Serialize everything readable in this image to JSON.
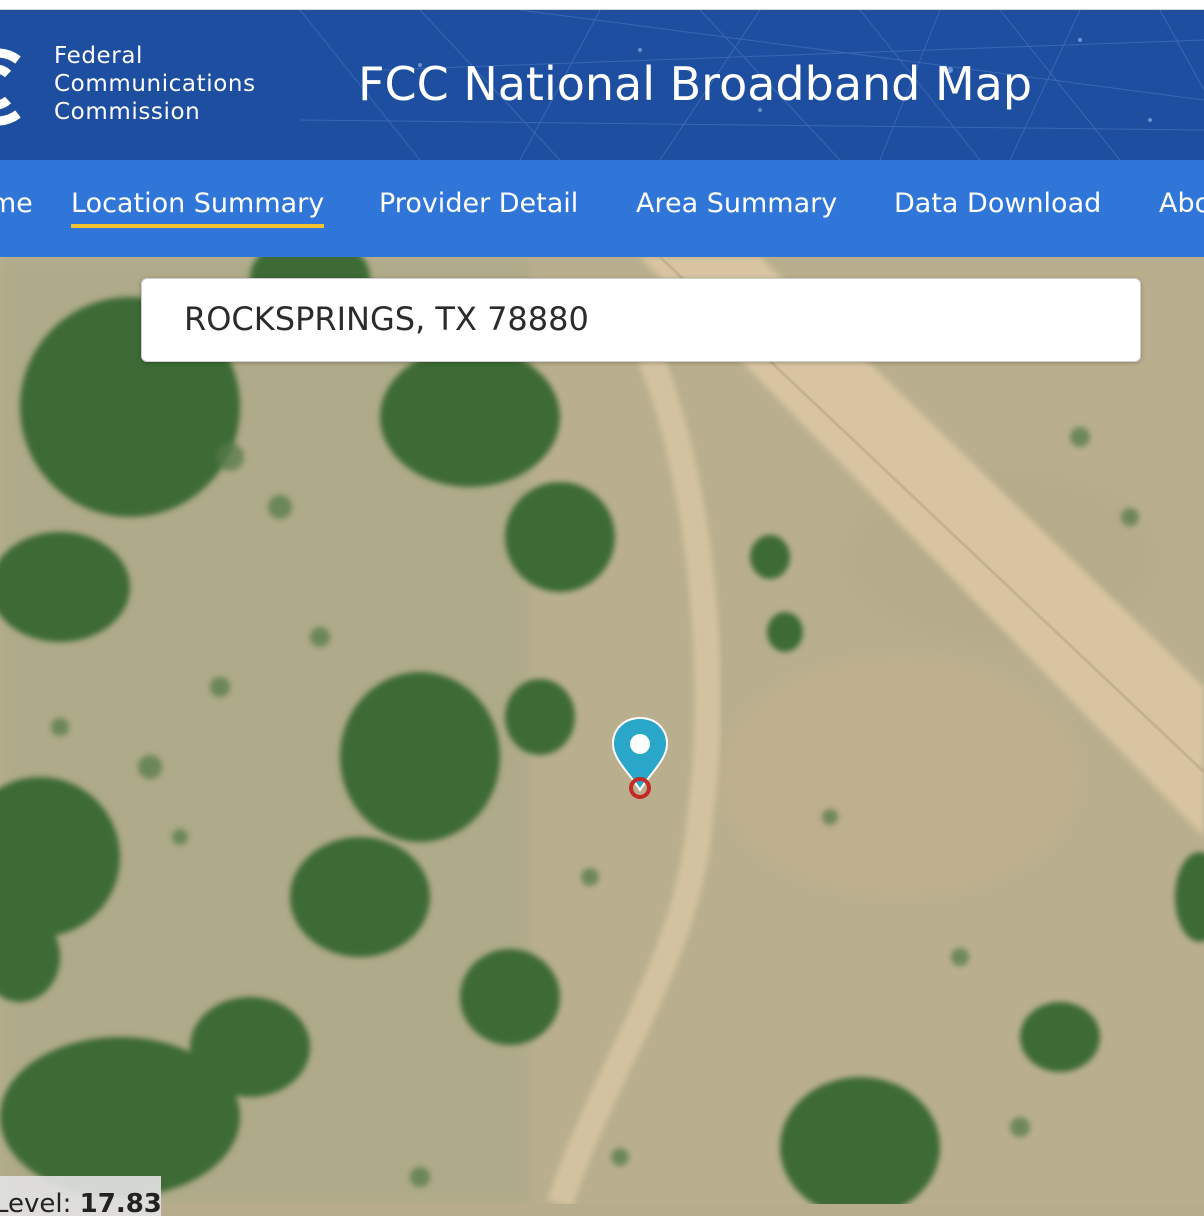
{
  "header": {
    "agency_lines": [
      "Federal",
      "Communications",
      "Commission"
    ],
    "site_title": "FCC National Broadband Map",
    "colors": {
      "header_bg": "#1e4ea0",
      "nav_bg": "#2f76d8",
      "active_underline": "#f2c230"
    }
  },
  "nav": {
    "items": [
      {
        "label": "Home",
        "active": false
      },
      {
        "label": "Location Summary",
        "active": true
      },
      {
        "label": "Provider Detail",
        "active": false
      },
      {
        "label": "Area Summary",
        "active": false
      },
      {
        "label": "Data Download",
        "active": false
      },
      {
        "label": "About",
        "active": false
      }
    ]
  },
  "search": {
    "value": "ROCKSPRINGS, TX 78880"
  },
  "map": {
    "view": "satellite",
    "marker_icon": "map-pin-icon",
    "zoom_label": "Level:",
    "zoom_value": "17.83"
  }
}
